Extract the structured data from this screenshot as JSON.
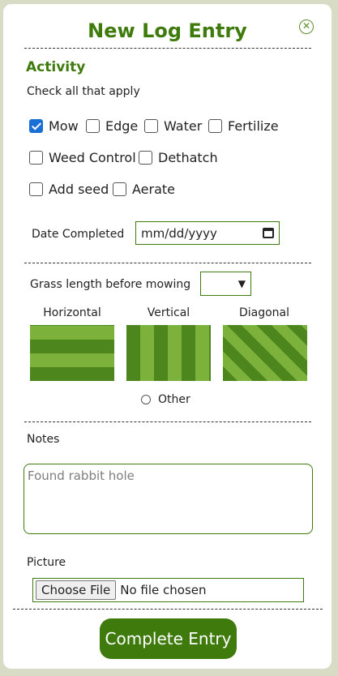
{
  "dialog": {
    "title": "New Log Entry",
    "close_icon": "close-icon"
  },
  "activity": {
    "heading": "Activity",
    "hint": "Check all that apply",
    "options": [
      {
        "label": "Mow",
        "checked": true
      },
      {
        "label": "Edge",
        "checked": false
      },
      {
        "label": "Water",
        "checked": false
      },
      {
        "label": "Fertilize",
        "checked": false
      },
      {
        "label": "Weed Control",
        "checked": false
      },
      {
        "label": "Dethatch",
        "checked": false
      },
      {
        "label": "Add seed",
        "checked": false
      },
      {
        "label": "Aerate",
        "checked": false
      }
    ]
  },
  "date": {
    "label": "Date Completed",
    "value": "mm/dd/yyyy",
    "icon": "calendar-icon"
  },
  "grass": {
    "label": "Grass length before mowing",
    "selected": "",
    "patterns": [
      {
        "label": "Horizontal",
        "selected": false
      },
      {
        "label": "Vertical",
        "selected": false
      },
      {
        "label": "Diagonal",
        "selected": false
      }
    ],
    "other_label": "Other",
    "other_selected": false
  },
  "notes": {
    "label": "Notes",
    "placeholder": "Found rabbit hole"
  },
  "picture": {
    "label": "Picture",
    "button_label": "Choose File",
    "status": "No file chosen"
  },
  "submit": {
    "label": "Complete Entry"
  },
  "colors": {
    "accent": "#3f7a0d",
    "checkbox": "#1a6fd6",
    "background": "#d8dcc4"
  }
}
